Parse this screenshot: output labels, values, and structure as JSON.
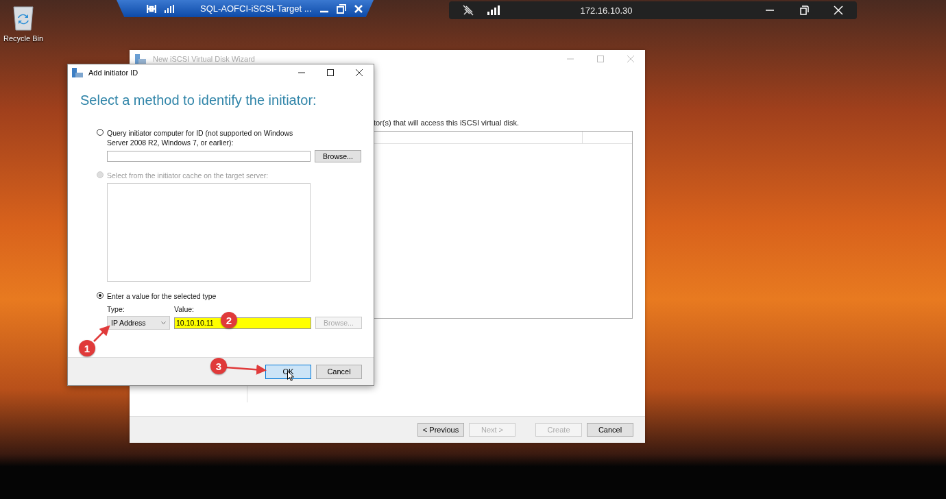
{
  "desktop": {
    "icons": [
      {
        "label": "Recycle Bin"
      }
    ]
  },
  "rdp_bar": {
    "title": "SQL-AOFCI-iSCSI-Target ..."
  },
  "remote_bar": {
    "title": "172.16.10.30"
  },
  "wizard": {
    "title": "New iSCSI Virtual Disk Wizard",
    "instruction": "tor(s) that will access this iSCSI virtual disk.",
    "buttons": [
      {
        "label": "< Previous",
        "disabled": false
      },
      {
        "label": "Next >",
        "disabled": true
      },
      {
        "label": "Create",
        "disabled": true
      },
      {
        "label": "Cancel",
        "disabled": false
      }
    ]
  },
  "dialog": {
    "title": "Add initiator ID",
    "heading": "Select a method to identify the initiator:",
    "options": [
      {
        "label": "Query initiator computer for ID (not supported on Windows Server 2008 R2, Windows 7, or earlier):",
        "selected": false,
        "disabled": false
      },
      {
        "label": "Select from the initiator cache on the target server:",
        "selected": false,
        "disabled": true
      },
      {
        "label": "Enter a value for the selected type",
        "selected": true,
        "disabled": false
      }
    ],
    "query_browse": {
      "label": "Browse...",
      "disabled": false
    },
    "type_label": "Type:",
    "type_value": "IP Address",
    "value_label": "Value:",
    "value": "10.10.10.11",
    "value_highlighted": true,
    "value_browse": {
      "label": "Browse...",
      "disabled": true
    },
    "buttons": [
      {
        "label": "OK",
        "focused": true
      },
      {
        "label": "Cancel",
        "focused": false
      }
    ]
  },
  "callouts": [
    {
      "number": "1",
      "arrow": true
    },
    {
      "number": "2",
      "arrow": false
    },
    {
      "number": "3",
      "arrow": true
    }
  ]
}
